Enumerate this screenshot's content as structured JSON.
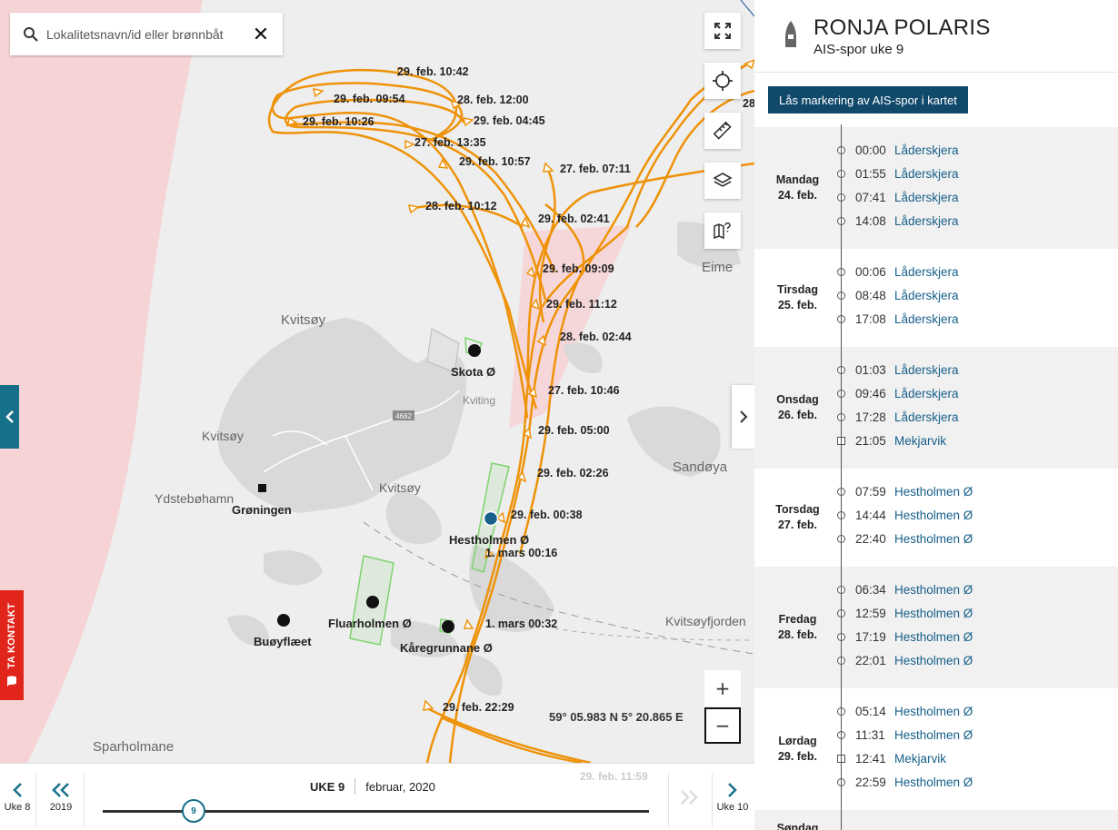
{
  "search": {
    "placeholder": "Lokalitetsnavn/id eller brønnbåt"
  },
  "map": {
    "places": {
      "kvitsoy_big": "Kvitsøy",
      "kvitsoy_small": "Kvitsøy",
      "kvitsoy_village": "Kvitsøy",
      "kviting": "Kviting",
      "ydstebohamn": "Ydstebøhamn",
      "eime": "Eime",
      "sandoya": "Sandøya",
      "kvitsoyfjorden": "Kvitsøyfjorden",
      "sparholmane": "Sparholmane",
      "road": "4682"
    },
    "pois": {
      "skota": "Skota Ø",
      "groningen": "Grøningen",
      "hestholmen": "Hestholmen Ø",
      "fluarholmen": "Fluarholmen Ø",
      "buoyflaet": "Buøyflæet",
      "karegrunnane": "Kåregrunnane Ø"
    },
    "track_labels": [
      "29. feb. 10:42",
      "29. feb. 09:54",
      "28. feb. 12:00",
      "29. feb. 10:26",
      "29. feb. 04:45",
      "27. feb. 13:35",
      "29. feb. 10:57",
      "27. feb. 07:11",
      "28. feb. 10:12",
      "29. feb. 02:41",
      "29. feb. 09:09",
      "29. feb. 11:12",
      "28. feb. 02:44",
      "27. feb. 10:46",
      "29. feb. 05:00",
      "29. feb. 02:26",
      "29. feb. 00:38",
      "1. mars 00:16",
      "1. mars 00:32",
      "29. feb. 22:29",
      "28"
    ],
    "coordinates": "59° 05.983 N 5° 20.865 E",
    "zoom_in": "+",
    "zoom_out": "−",
    "contact": "TA KONTAKT",
    "colors": {
      "track": "#ee9208",
      "sea_zone": "#f6d4d6",
      "green_zone": "#7ed36f",
      "accent": "#17708a"
    }
  },
  "timebar": {
    "prev_week": "Uke 8",
    "prev_year": "2019",
    "week": "UKE 9",
    "month": "februar, 2020",
    "thumb": "9",
    "next_week": "Uke 10",
    "ghost_label": "29. feb. 11:59"
  },
  "panel": {
    "vessel": "RONJA POLARIS",
    "subtitle": "AIS-spor uke 9",
    "lock_button": "Lås markering av AIS-spor i kartet",
    "days": [
      {
        "name": "Mandag",
        "date": "24. feb.",
        "entries": [
          {
            "time": "00:00",
            "loc": "Låderskjera",
            "type": "circle"
          },
          {
            "time": "01:55",
            "loc": "Låderskjera",
            "type": "circle"
          },
          {
            "time": "07:41",
            "loc": "Låderskjera",
            "type": "circle"
          },
          {
            "time": "14:08",
            "loc": "Låderskjera",
            "type": "circle"
          }
        ]
      },
      {
        "name": "Tirsdag",
        "date": "25. feb.",
        "entries": [
          {
            "time": "00:06",
            "loc": "Låderskjera",
            "type": "circle"
          },
          {
            "time": "08:48",
            "loc": "Låderskjera",
            "type": "circle"
          },
          {
            "time": "17:08",
            "loc": "Låderskjera",
            "type": "circle"
          }
        ]
      },
      {
        "name": "Onsdag",
        "date": "26. feb.",
        "entries": [
          {
            "time": "01:03",
            "loc": "Låderskjera",
            "type": "circle"
          },
          {
            "time": "09:46",
            "loc": "Låderskjera",
            "type": "circle"
          },
          {
            "time": "17:28",
            "loc": "Låderskjera",
            "type": "circle"
          },
          {
            "time": "21:05",
            "loc": "Mekjarvik",
            "type": "square"
          }
        ]
      },
      {
        "name": "Torsdag",
        "date": "27. feb.",
        "entries": [
          {
            "time": "07:59",
            "loc": "Hestholmen Ø",
            "type": "circle"
          },
          {
            "time": "14:44",
            "loc": "Hestholmen Ø",
            "type": "circle"
          },
          {
            "time": "22:40",
            "loc": "Hestholmen Ø",
            "type": "circle"
          }
        ]
      },
      {
        "name": "Fredag",
        "date": "28. feb.",
        "entries": [
          {
            "time": "06:34",
            "loc": "Hestholmen Ø",
            "type": "circle"
          },
          {
            "time": "12:59",
            "loc": "Hestholmen Ø",
            "type": "circle"
          },
          {
            "time": "17:19",
            "loc": "Hestholmen Ø",
            "type": "circle"
          },
          {
            "time": "22:01",
            "loc": "Hestholmen Ø",
            "type": "circle"
          }
        ]
      },
      {
        "name": "Lørdag",
        "date": "29. feb.",
        "entries": [
          {
            "time": "05:14",
            "loc": "Hestholmen Ø",
            "type": "circle"
          },
          {
            "time": "11:31",
            "loc": "Hestholmen Ø",
            "type": "circle"
          },
          {
            "time": "12:41",
            "loc": "Mekjarvik",
            "type": "square"
          },
          {
            "time": "22:59",
            "loc": "Hestholmen Ø",
            "type": "circle"
          }
        ]
      },
      {
        "name": "Søndag",
        "date": "",
        "entries": []
      }
    ]
  }
}
